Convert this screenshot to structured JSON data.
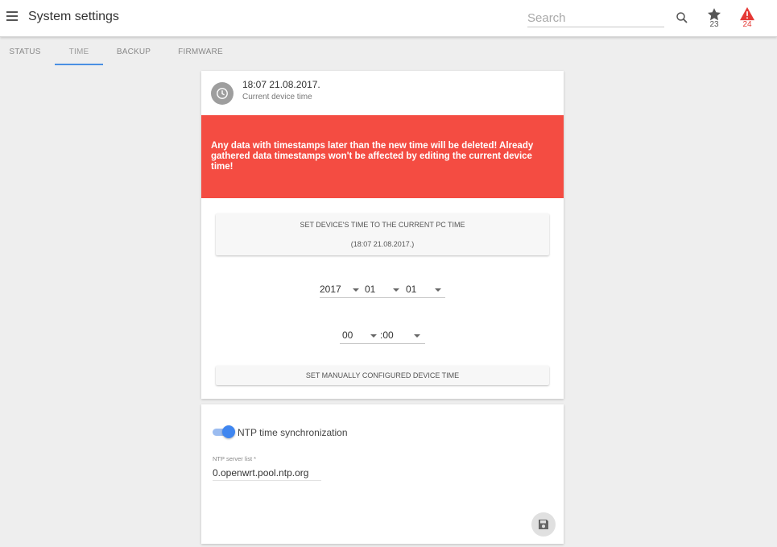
{
  "app": {
    "title": "System settings"
  },
  "search": {
    "placeholder": "Search"
  },
  "badges": {
    "favorites_count": "23",
    "alerts_count": "24"
  },
  "tabs": [
    {
      "label": "STATUS"
    },
    {
      "label": "TIME",
      "active": true
    },
    {
      "label": "BACKUP"
    },
    {
      "label": "FIRMWARE"
    }
  ],
  "time_card": {
    "current_time": "18:07 21.08.2017.",
    "current_time_caption": "Current device time",
    "warning": "Any data with timestamps later than the new time will be deleted! Already gathered data timestamps won't be affected by editing the current device time!",
    "pc_button_label": "SET DEVICE'S TIME TO THE CURRENT PC TIME",
    "pc_button_time": "(18:07 21.08.2017.)",
    "year": "2017",
    "month": "01",
    "day": "01",
    "hour": "00",
    "minute": ":00",
    "manual_button_label": "SET MANUALLY CONFIGURED DEVICE TIME"
  },
  "ntp_card": {
    "toggle_label": "NTP time synchronization",
    "toggle_on": true,
    "server_list_label": "NTP server list *",
    "server_list_value": "0.openwrt.pool.ntp.org"
  },
  "colors": {
    "accent": "#3f86f0",
    "warning_bg": "#f44c42",
    "alert": "#e53935"
  },
  "icons": [
    "menu-icon",
    "search-icon",
    "star-icon",
    "alert-icon",
    "clock-icon",
    "save-icon"
  ]
}
